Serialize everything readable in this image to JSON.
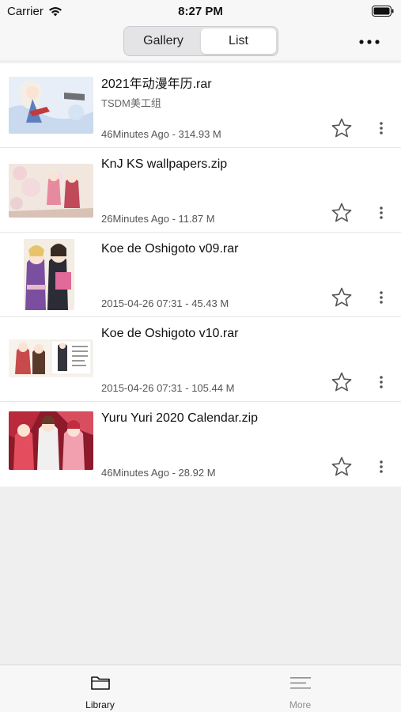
{
  "status_bar": {
    "carrier": "Carrier",
    "time": "8:27 PM"
  },
  "segmented": {
    "gallery": "Gallery",
    "list": "List",
    "selected": "List"
  },
  "files": [
    {
      "name": "2021年动漫年历.rar",
      "subtitle": "TSDM美工组",
      "meta": "46Minutes Ago - 314.93 M"
    },
    {
      "name": "KnJ KS wallpapers.zip",
      "subtitle": "",
      "meta": "26Minutes Ago - 11.87 M"
    },
    {
      "name": "Koe de Oshigoto v09.rar",
      "subtitle": "",
      "meta": "2015-04-26 07:31 - 45.43 M"
    },
    {
      "name": "Koe de Oshigoto v10.rar",
      "subtitle": "",
      "meta": "2015-04-26 07:31 - 105.44 M"
    },
    {
      "name": "Yuru Yuri 2020 Calendar.zip",
      "subtitle": "",
      "meta": "46Minutes Ago - 28.92 M"
    }
  ],
  "tab_bar": {
    "library": "Library",
    "more": "More",
    "active": "Library"
  },
  "colors": {
    "accent_text": "#111111",
    "inactive_tab": "#8e8e93",
    "background": "#efefef"
  },
  "icons": [
    "wifi-icon",
    "battery-icon",
    "more-horizontal-icon",
    "star-outline-icon",
    "kebab-vertical-icon",
    "folder-icon",
    "hamburger-icon"
  ]
}
